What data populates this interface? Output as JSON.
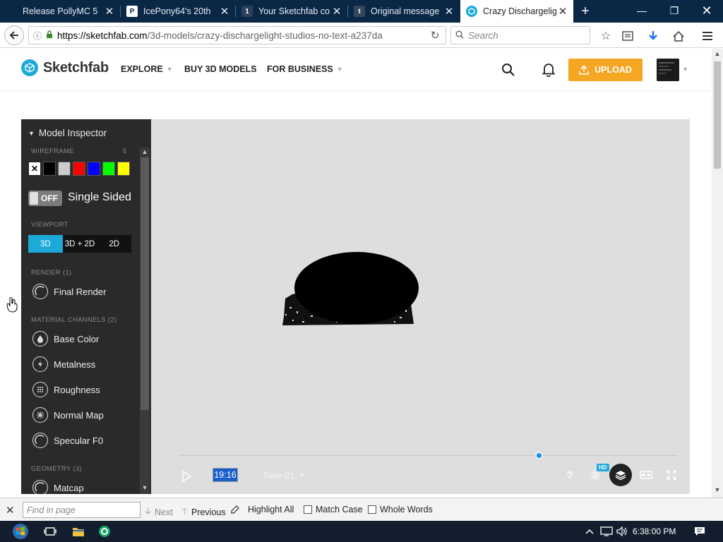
{
  "browser": {
    "tabs": [
      {
        "title": "Release PollyMC 5",
        "favicon": "P",
        "active": false
      },
      {
        "title": "IcePony64's 20th",
        "favicon": "P",
        "active": false
      },
      {
        "title": "Your Sketchfab co",
        "favicon": "1",
        "active": false
      },
      {
        "title": "Original message",
        "favicon": "t",
        "active": false
      },
      {
        "title": "Crazy Dischargelig",
        "favicon": "S",
        "active": true
      }
    ],
    "url_prefix": "https://sketchfab.com",
    "url_path": "/3d-models/crazy-dischargelight-studios-no-text-a237da",
    "search_placeholder": "Search"
  },
  "site": {
    "brand": "Sketchfab",
    "nav": [
      {
        "label": "EXPLORE",
        "has_caret": true
      },
      {
        "label": "BUY 3D MODELS",
        "has_caret": false
      },
      {
        "label": "FOR BUSINESS",
        "has_caret": true
      }
    ],
    "upload_label": "UPLOAD",
    "accent": "#1caad9",
    "upload_color": "#f5a623"
  },
  "inspector": {
    "title": "Model Inspector",
    "wireframe": {
      "label": "WIREFRAME",
      "count": "5",
      "colors": [
        "none",
        "#000000",
        "#cccccc",
        "#ff0000",
        "#0000ff",
        "#00ff00",
        "#ffff00"
      ]
    },
    "single_sided": {
      "state": "OFF",
      "label": "Single Sided"
    },
    "viewport": {
      "label": "VIEWPORT",
      "options": [
        "3D",
        "3D + 2D",
        "2D"
      ],
      "selected": "3D"
    },
    "render": {
      "label": "RENDER (1)",
      "items": [
        "Final Render"
      ]
    },
    "material_channels": {
      "label": "MATERIAL CHANNELS (2)",
      "items": [
        "Base Color",
        "Metalness",
        "Roughness",
        "Normal Map",
        "Specular F0"
      ]
    },
    "geometry": {
      "label": "GEOMETRY (3)",
      "items": [
        "Matcap"
      ]
    }
  },
  "viewer": {
    "timecode": "19:16",
    "take": "Take 01",
    "hd_badge": "HD",
    "timeline_position": 0.77
  },
  "findbar": {
    "placeholder": "Find in page",
    "next": "Next",
    "previous": "Previous",
    "highlight_all": "Highlight All",
    "match_case": "Match Case",
    "whole_words": "Whole Words"
  },
  "taskbar": {
    "time": "6:38:00 PM"
  }
}
